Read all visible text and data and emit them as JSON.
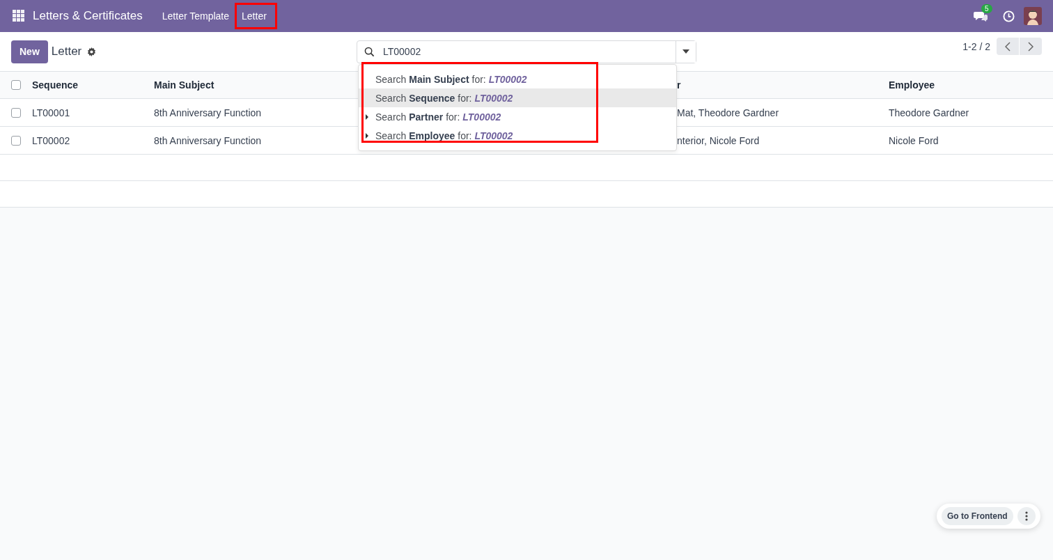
{
  "navbar": {
    "app_title": "Letters & Certificates",
    "menu": [
      {
        "label": "Letter Template",
        "highlighted": false
      },
      {
        "label": "Letter",
        "highlighted": true
      }
    ],
    "messages_badge": "5"
  },
  "control_panel": {
    "new_button": "New",
    "breadcrumb": "Letter",
    "search": {
      "value": "LT00002"
    },
    "pager": "1-2 / 2"
  },
  "search_suggestions": {
    "highlighted": true,
    "items": [
      {
        "prefix": "Search",
        "field": "Main Subject",
        "middle": "for:",
        "term": "LT00002",
        "expandable": false,
        "selected": false
      },
      {
        "prefix": "Search",
        "field": "Sequence",
        "middle": "for:",
        "term": "LT00002",
        "expandable": false,
        "selected": true
      },
      {
        "prefix": "Search",
        "field": "Partner",
        "middle": "for:",
        "term": "LT00002",
        "expandable": true,
        "selected": false
      },
      {
        "prefix": "Search",
        "field": "Employee",
        "middle": "for:",
        "term": "LT00002",
        "expandable": true,
        "selected": false
      }
    ]
  },
  "table": {
    "all_checked": false,
    "columns": [
      "Sequence",
      "Main Subject",
      "r",
      "Employee"
    ],
    "rows": [
      {
        "checked": false,
        "cells": [
          "LT00001",
          "8th Anniversary Function",
          "Mat, Theodore Gardner",
          "Theodore Gardner"
        ]
      },
      {
        "checked": false,
        "cells": [
          "LT00002",
          "8th Anniversary Function",
          "nterior, Nicole Ford",
          "Nicole Ford"
        ]
      }
    ]
  },
  "floating_button": "Go to Frontend"
}
